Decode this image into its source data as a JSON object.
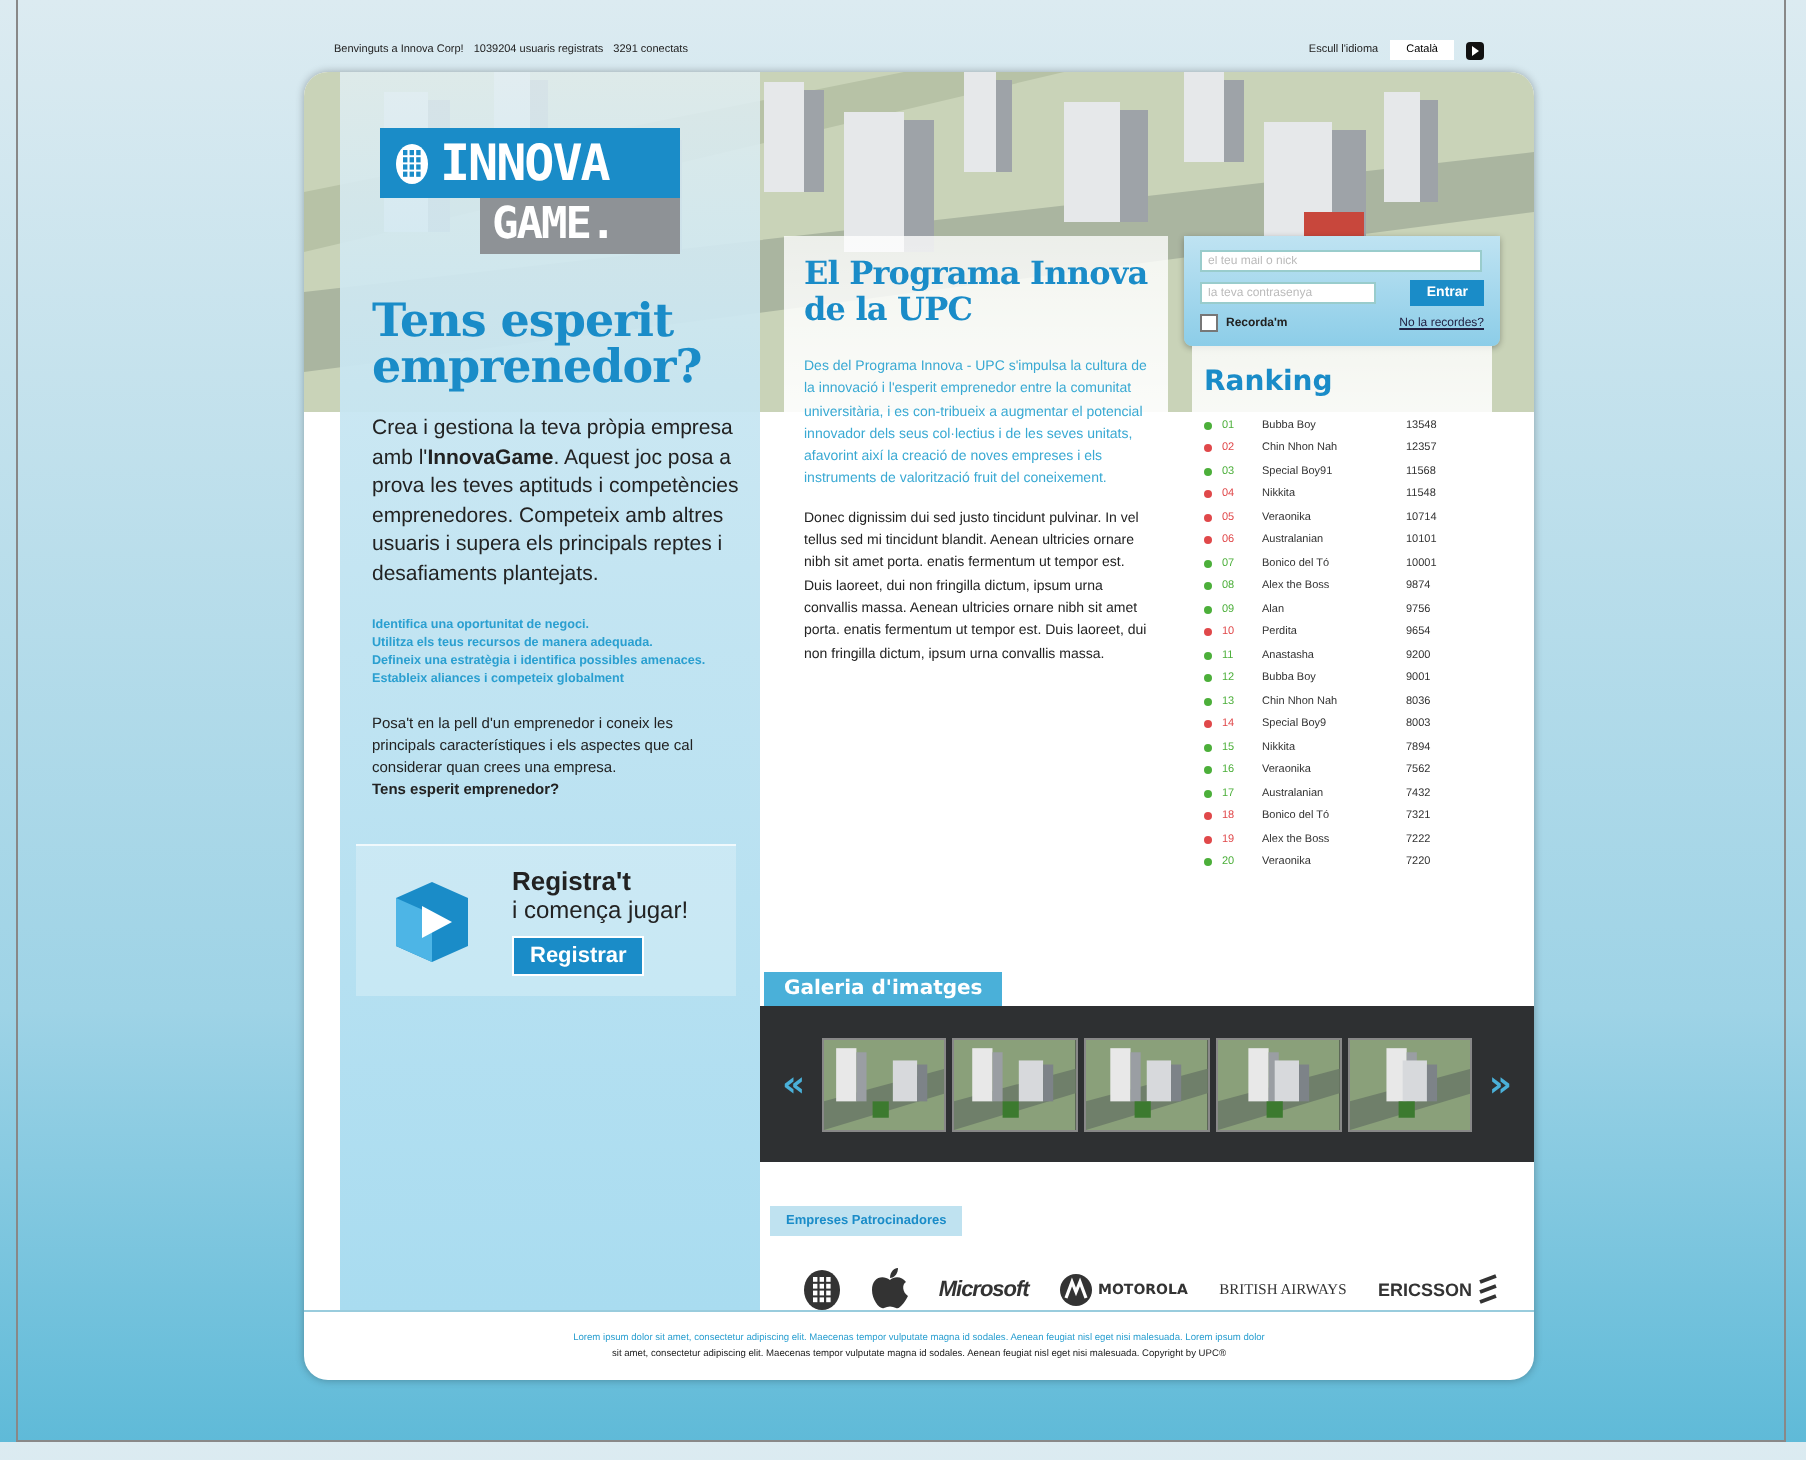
{
  "top_bar": {
    "welcome": "Benvinguts a Innova Corp!",
    "registered": "1039204 usuaris registrats",
    "online": "3291 conectats",
    "language_label": "Escull l'idioma",
    "language": "Català"
  },
  "logo": {
    "line_1": "INNOVA",
    "line_2": "GAME."
  },
  "intro": {
    "title": "Tens esperit emprenedor?",
    "text": "Crea i gestiona la teva pròpia empresa amb l'**InnovaGame**. Aquest joc posa a prova les teves aptituds i competències emprenedores. Competeix amb altres usuaris i supera els principals reptes i desafiaments plantejats.",
    "goals": [
      "Identifica una oportunitat de negoci.",
      "Utilitza els teus recursos de manera adequada.",
      "Defineix una estratègia i identifica possibles amenaces.",
      "Estableix aliances i competeix globalment"
    ],
    "closing": "Posa't en la pell d'un emprenedor i coneix les principals característiques i els aspectes que cal considerar quan crees una empresa.",
    "question": "Tens esperit emprenedor?"
  },
  "register": {
    "title": "Registra't",
    "subtitle": "i comença jugar!",
    "button": "Registrar"
  },
  "program": {
    "title": "El Programa Innova de la UPC",
    "lead": "Des del Programa Innova - UPC s'impulsa la cultura de la innovació i l'esperit emprenedor entre la comunitat universitària, i es con-tribueix a augmentar el potencial innovador dels seus col·lectius i de les seves unitats, afavorint així la creació de noves empreses i els instruments de valorització fruit del coneixement.",
    "body": "Donec dignissim dui sed justo tincidunt pulvinar. In vel tellus sed mi tincidunt blandit. Aenean ultricies ornare nibh sit amet porta. enatis fermentum ut tempor est. Duis laoreet, dui non fringilla dictum, ipsum urna convallis massa. Aenean ultricies ornare nibh sit amet porta. enatis fermentum ut tempor est. Duis laoreet, dui non fringilla dictum, ipsum urna convallis massa."
  },
  "login": {
    "user_placeholder": "el teu mail o nick",
    "password_placeholder": "la teva contrasenya",
    "button": "Entrar",
    "remember": "Recorda'm",
    "remember_checked": false,
    "forgot": "No la recordes?"
  },
  "ranking": {
    "title": "Ranking",
    "rows": [
      {
        "rank": "01",
        "name": "Bubba Boy",
        "score": "13548",
        "color": "#4caf3a"
      },
      {
        "rank": "02",
        "name": "Chin Nhon Nah",
        "score": "12357",
        "color": "#e0484a"
      },
      {
        "rank": "03",
        "name": "Special Boy91",
        "score": "11568",
        "color": "#4caf3a"
      },
      {
        "rank": "04",
        "name": "Nikkita",
        "score": "11548",
        "color": "#e0484a"
      },
      {
        "rank": "05",
        "name": "Veraonika",
        "score": "10714",
        "color": "#e0484a"
      },
      {
        "rank": "06",
        "name": "Australanian",
        "score": "10101",
        "color": "#e0484a"
      },
      {
        "rank": "07",
        "name": "Bonico del Tó",
        "score": "10001",
        "color": "#4caf3a"
      },
      {
        "rank": "08",
        "name": "Alex the Boss",
        "score": "9874",
        "color": "#4caf3a"
      },
      {
        "rank": "09",
        "name": "Alan",
        "score": "9756",
        "color": "#4caf3a"
      },
      {
        "rank": "10",
        "name": "Perdita",
        "score": "9654",
        "color": "#e0484a"
      },
      {
        "rank": "11",
        "name": "Anastasha",
        "score": "9200",
        "color": "#4caf3a"
      },
      {
        "rank": "12",
        "name": "Bubba Boy",
        "score": "9001",
        "color": "#4caf3a"
      },
      {
        "rank": "13",
        "name": "Chin Nhon Nah",
        "score": "8036",
        "color": "#4caf3a"
      },
      {
        "rank": "14",
        "name": "Special Boy9",
        "score": "8003",
        "color": "#e0484a"
      },
      {
        "rank": "15",
        "name": "Nikkita",
        "score": "7894",
        "color": "#4caf3a"
      },
      {
        "rank": "16",
        "name": "Veraonika",
        "score": "7562",
        "color": "#4caf3a"
      },
      {
        "rank": "17",
        "name": "Australanian",
        "score": "7432",
        "color": "#4caf3a"
      },
      {
        "rank": "18",
        "name": "Bonico del Tó",
        "score": "7321",
        "color": "#e0484a"
      },
      {
        "rank": "19",
        "name": "Alex the Boss",
        "score": "7222",
        "color": "#e0484a"
      },
      {
        "rank": "20",
        "name": "Veraonika",
        "score": "7220",
        "color": "#4caf3a"
      }
    ]
  },
  "gallery": {
    "title": "Galeria d'imatges",
    "prev": "«",
    "next": "»"
  },
  "sponsors": {
    "title": "Empreses Patrocinadores",
    "logos": [
      {
        "kind": "upc"
      },
      {
        "kind": "apple"
      },
      {
        "kind": "microsoft",
        "label": "Microsoft"
      },
      {
        "kind": "motorola",
        "label": "MOTOROLA"
      },
      {
        "kind": "british",
        "label": "BRITISH AIRWAYS"
      },
      {
        "kind": "ericsson",
        "label": "ERICSSON"
      }
    ]
  },
  "footer": {
    "line_1": "Lorem ipsum dolor sit amet, consectetur adipiscing elit. Maecenas tempor vulputate magna id sodales. Aenean feugiat nisl eget nisi malesuada. Lorem ipsum dolor",
    "line_2": "sit amet, consectetur adipiscing elit. Maecenas tempor vulputate magna id sodales. Aenean feugiat nisl eget nisi malesuada. Copyright by UPC®"
  }
}
